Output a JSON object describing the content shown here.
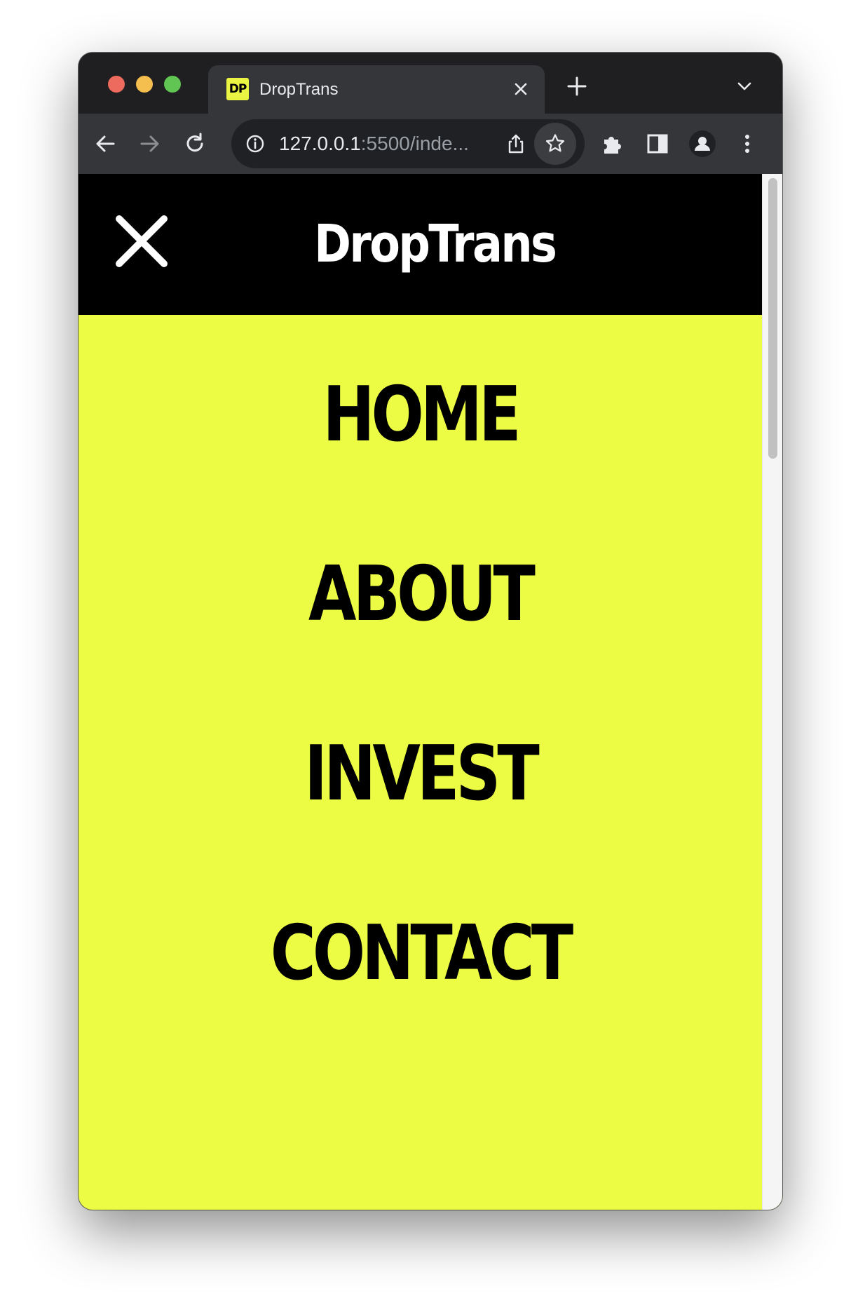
{
  "browser": {
    "tab": {
      "favicon_text": "DP",
      "title": "DropTrans"
    },
    "omnibox": {
      "host": "127.0.0.1",
      "rest": ":5500/inde..."
    },
    "colors": {
      "tab_bar": "#1f1f21",
      "toolbar": "#35363a",
      "favicon_bg": "#e9f542"
    }
  },
  "site": {
    "brand": "DropTrans",
    "menu": [
      {
        "label": "HOME"
      },
      {
        "label": "ABOUT"
      },
      {
        "label": "INVEST"
      },
      {
        "label": "CONTACT"
      }
    ],
    "colors": {
      "header_bg": "#000000",
      "menu_bg": "#ecfc45",
      "text": "#000000"
    }
  },
  "icons": {
    "close_menu": "close-icon",
    "back": "arrow-left-icon",
    "forward": "arrow-right-icon",
    "reload": "reload-icon",
    "info": "info-icon",
    "share": "share-icon",
    "bookmark": "star-icon",
    "extensions": "puzzle-icon",
    "side_panel": "side-panel-icon",
    "profile": "profile-icon",
    "menu": "kebab-menu-icon"
  }
}
